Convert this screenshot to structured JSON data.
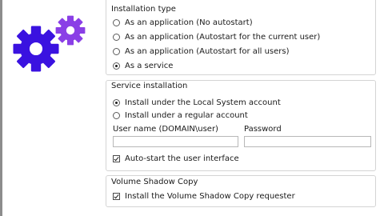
{
  "installation_type": {
    "title": "Installation type",
    "options": [
      {
        "label": "As an application (No autostart)",
        "checked": false
      },
      {
        "label": "As an application (Autostart for the current user)",
        "checked": false
      },
      {
        "label": "As an application (Autostart for all users)",
        "checked": false
      },
      {
        "label": "As a service",
        "checked": true
      }
    ]
  },
  "service_installation": {
    "title": "Service installation",
    "options": [
      {
        "label": "Install under the Local System account",
        "checked": true
      },
      {
        "label": "Install under a regular account",
        "checked": false
      }
    ],
    "username_label": "User name (DOMAIN\\user)",
    "username_value": "",
    "password_label": "Password",
    "password_value": "",
    "autostart_label": "Auto-start the user interface",
    "autostart_checked": true
  },
  "volume_shadow_copy": {
    "title": "Volume Shadow Copy",
    "requester_label": "Install the Volume Shadow Copy requester",
    "requester_checked": true
  },
  "colors": {
    "gear_primary": "#3a12e0",
    "gear_secondary": "#8a3fe6"
  }
}
